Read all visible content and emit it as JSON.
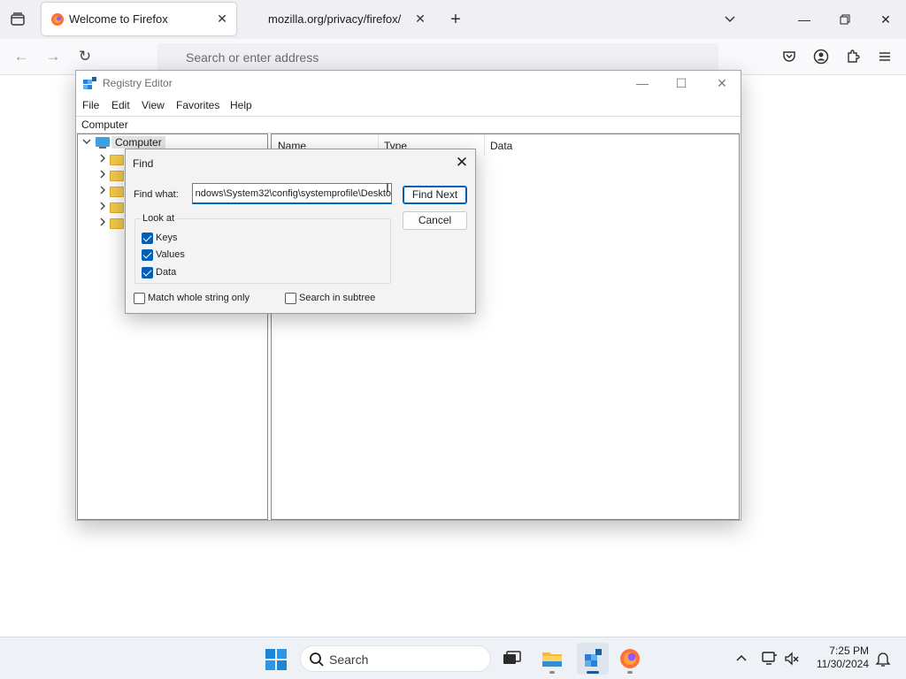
{
  "browser": {
    "tabs": [
      {
        "title": "Welcome to Firefox",
        "active": true
      },
      {
        "title": "mozilla.org/privacy/firefox/",
        "active": false
      }
    ],
    "url_placeholder": "Search or enter address"
  },
  "regedit": {
    "title": "Registry Editor",
    "menu": [
      "File",
      "Edit",
      "View",
      "Favorites",
      "Help"
    ],
    "address": "Computer",
    "tree_root": "Computer",
    "columns": [
      "Name",
      "Type",
      "Data"
    ]
  },
  "find_dialog": {
    "title": "Find",
    "find_what_label": "Find what:",
    "find_what_value": "ndows\\System32\\config\\systemprofile\\Deskto",
    "find_next_label": "Find Next",
    "cancel_label": "Cancel",
    "look_at_label": "Look at",
    "keys_label": "Keys",
    "keys_checked": true,
    "values_label": "Values",
    "values_checked": true,
    "data_label": "Data",
    "data_checked": true,
    "match_whole_label": "Match whole string only",
    "match_whole_checked": false,
    "subtree_label": "Search in subtree",
    "subtree_checked": false
  },
  "taskbar": {
    "search_placeholder": "Search",
    "time": "7:25 PM",
    "date": "11/30/2024"
  },
  "colors": {
    "accent": "#005fb8",
    "folder": "#f2c94c",
    "computer_icon": "#3aa0e8"
  }
}
